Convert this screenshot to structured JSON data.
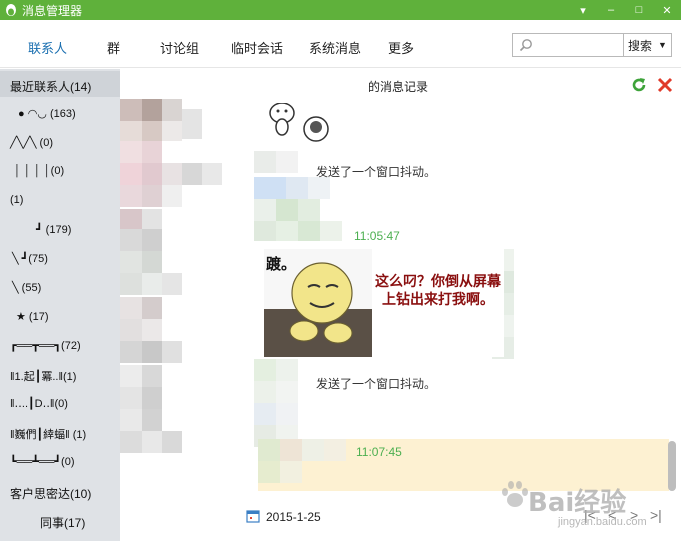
{
  "window": {
    "title": "消息管理器",
    "min": "▾",
    "restore": "–",
    "max": "□",
    "close": "✕"
  },
  "tabs": [
    {
      "label": "联系人",
      "active": true
    },
    {
      "label": "群"
    },
    {
      "label": "讨论组"
    },
    {
      "label": "临时会话"
    },
    {
      "label": "系统消息"
    },
    {
      "label": "更多"
    }
  ],
  "search": {
    "placeholder": "",
    "button": "搜索",
    "caret": "▼"
  },
  "contacts": [
    "最近联系人(14)",
    "●  ◠◡  (163)",
    "╱╲╱╲ (0)",
    "│ │   │ │(0)",
    "(1)",
    "┛  (179)",
    "╲  ┛(75)",
    "╲  (55)",
    "★   (17)",
    "┏══┳══┓(72)",
    "‖1.起┃冪..‖(1)",
    "‖‥..┃D‥‖(0)",
    "‖巍們┃緈蝠‖ (1)",
    "┗══┻══┛(0)",
    "客户思密达(10)",
    "同事(17)"
  ],
  "chat": {
    "header": "的消息记录",
    "messages": [
      {
        "text": "发送了一个窗口抖动。"
      },
      {
        "time": "11:05:47"
      },
      {
        "text": "发送了一个窗口抖动。"
      },
      {
        "time": "11:07:45"
      }
    ],
    "meme": {
      "side": "踱。",
      "caption": "这么叼？你倒从屏幕上钻出来打我啊。"
    },
    "date": "2015-1-25",
    "nav": [
      "|<",
      "<",
      ">",
      ">|"
    ]
  },
  "watermark": {
    "main": "Bai经验",
    "sub": "jingyan.baidu.com"
  },
  "colors": {
    "accent": "#5fb13b",
    "tab_active": "#1a6fb0",
    "time": "#4caf50",
    "highlight": "#fdf1d2"
  }
}
